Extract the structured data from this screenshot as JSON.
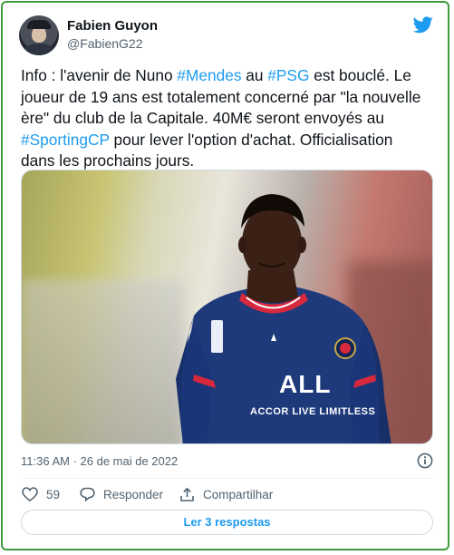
{
  "author": {
    "name": "Fabien Guyon",
    "handle": "@FabienG22"
  },
  "tweet": {
    "parts": [
      {
        "text": "Info : l'avenir de Nuno ",
        "tag": false
      },
      {
        "text": "#Mendes",
        "tag": true
      },
      {
        "text": " au ",
        "tag": false
      },
      {
        "text": "#PSG",
        "tag": true
      },
      {
        "text": " est bouclé. Le joueur de 19 ans est totalement concerné par \"la nouvelle ère\" du club de la Capitale. 40M€ seront envoyés au ",
        "tag": false
      },
      {
        "text": "#SportingCP",
        "tag": true
      },
      {
        "text": " pour lever l'option d'achat. Officialisation dans les prochains jours.",
        "tag": false
      }
    ]
  },
  "media": {
    "jersey_sponsor": "ALL",
    "jersey_sponsor_line2": "ACCOR LIVE LIMITLESS",
    "crest_text": "PSG"
  },
  "meta": {
    "timestamp": "11:36 AM · 26 de mai de 2022"
  },
  "actions": {
    "like_count": "59",
    "reply_label": "Responder",
    "share_label": "Compartilhar"
  },
  "replies_label": "Ler 3 respostas",
  "colors": {
    "accent": "#1d9bf0",
    "frame": "#3d9a3d",
    "text": "#0f1419",
    "muted": "#536471"
  }
}
